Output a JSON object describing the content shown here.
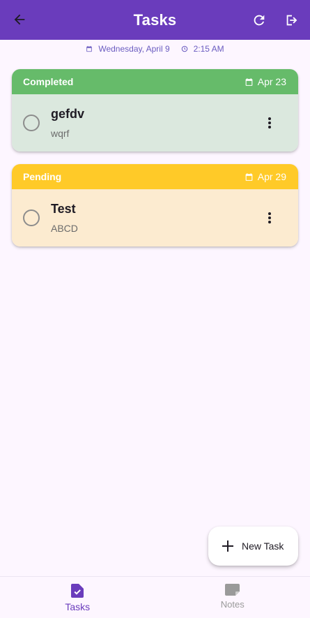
{
  "appbar": {
    "title": "Tasks",
    "back_icon": "arrow-back-icon",
    "refresh_icon": "refresh-icon",
    "logout_icon": "logout-icon",
    "color": "#6a3cbc"
  },
  "datetime": {
    "date": "Wednesday, April 9",
    "time": "2:15 AM"
  },
  "tasks": [
    {
      "status": "Completed",
      "due": "Apr 23",
      "title": "gefdv",
      "description": "wqrf",
      "header_color": "#66bb6a",
      "body_color": "#dbe8de"
    },
    {
      "status": "Pending",
      "due": "Apr 29",
      "title": "Test",
      "description": "ABCD",
      "header_color": "#ffca28",
      "body_color": "#fcebd0"
    }
  ],
  "fab": {
    "label": "New Task",
    "icon": "plus-icon"
  },
  "bottom_nav": [
    {
      "label": "Tasks",
      "icon": "task-document-icon",
      "active": true
    },
    {
      "label": "Notes",
      "icon": "note-icon",
      "active": false
    }
  ]
}
